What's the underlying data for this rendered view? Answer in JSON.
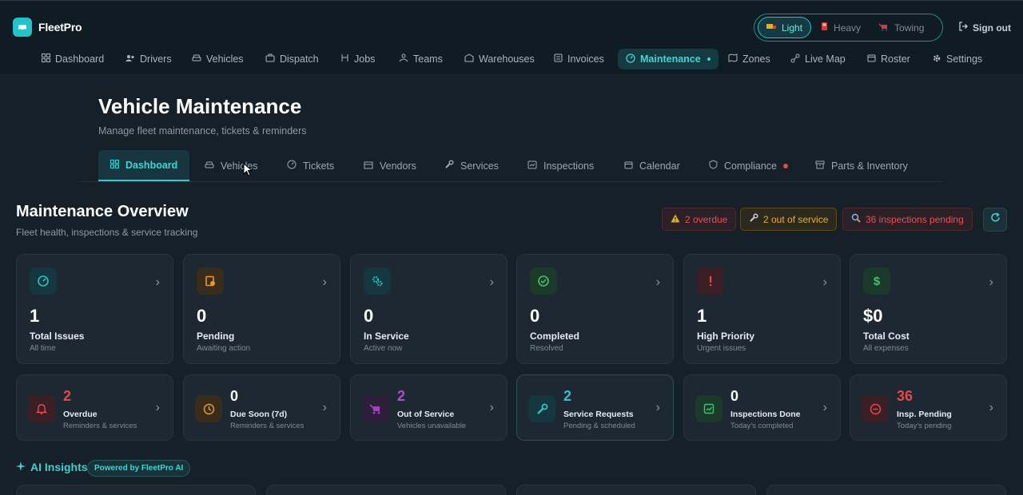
{
  "app": {
    "name": "FleetPro"
  },
  "modes": [
    {
      "label": "Light",
      "icon": "truck-icon",
      "active": true
    },
    {
      "label": "Heavy",
      "icon": "fuel-icon",
      "active": false
    },
    {
      "label": "Towing",
      "icon": "tow-truck-icon",
      "active": false
    }
  ],
  "signout": "Sign out",
  "nav": [
    {
      "label": "Dashboard",
      "icon": "grid-icon"
    },
    {
      "label": "Drivers",
      "icon": "users-icon"
    },
    {
      "label": "Vehicles",
      "icon": "car-icon"
    },
    {
      "label": "Dispatch",
      "icon": "briefcase-icon"
    },
    {
      "label": "Jobs",
      "icon": "jobs-icon"
    },
    {
      "label": "Teams",
      "icon": "team-icon"
    },
    {
      "label": "Warehouses",
      "icon": "warehouse-icon"
    },
    {
      "label": "Invoices",
      "icon": "invoice-icon"
    },
    {
      "label": "Maintenance",
      "icon": "gauge-icon",
      "active": true
    },
    {
      "label": "Zones",
      "icon": "map-icon"
    },
    {
      "label": "Live Map",
      "icon": "route-icon"
    },
    {
      "label": "Roster",
      "icon": "calendar-icon"
    },
    {
      "label": "Settings",
      "icon": "gear-icon"
    }
  ],
  "page": {
    "title": "Vehicle Maintenance",
    "subtitle": "Manage fleet maintenance, tickets & reminders"
  },
  "tabs": [
    {
      "label": "Dashboard",
      "icon": "grid-icon",
      "active": true
    },
    {
      "label": "Vehicles",
      "icon": "car-icon"
    },
    {
      "label": "Tickets",
      "icon": "gauge-icon"
    },
    {
      "label": "Vendors",
      "icon": "vendor-icon"
    },
    {
      "label": "Services",
      "icon": "wrench-icon"
    },
    {
      "label": "Inspections",
      "icon": "clipboard-icon"
    },
    {
      "label": "Calendar",
      "icon": "calendar-icon"
    },
    {
      "label": "Compliance",
      "icon": "shield-icon",
      "alert": true
    },
    {
      "label": "Parts & Inventory",
      "icon": "box-icon"
    }
  ],
  "overview": {
    "title": "Maintenance Overview",
    "subtitle": "Fleet health, inspections & service tracking",
    "alerts": [
      {
        "label": "2 overdue",
        "icon": "warning-icon",
        "color": "#e8524f"
      },
      {
        "label": "2 out of service",
        "icon": "wrench-icon",
        "color": "#e4b026"
      },
      {
        "label": "36 inspections pending",
        "icon": "magnifier-icon",
        "color": "#e8524f"
      }
    ]
  },
  "stats": [
    {
      "value": "1",
      "label": "Total Issues",
      "sub": "All time",
      "icon": "gauge-icon",
      "color": "#2fc1c4"
    },
    {
      "value": "0",
      "label": "Pending",
      "sub": "Awaiting action",
      "icon": "clipboard-clock-icon",
      "color": "#e49b2b"
    },
    {
      "value": "0",
      "label": "In Service",
      "sub": "Active now",
      "icon": "gears-icon",
      "color": "#2fc1c4"
    },
    {
      "value": "0",
      "label": "Completed",
      "sub": "Resolved",
      "icon": "check-circle-icon",
      "color": "#3ec46d"
    },
    {
      "value": "1",
      "label": "High Priority",
      "sub": "Urgent issues",
      "icon": "exclamation-icon",
      "color": "#e24a4a"
    },
    {
      "value": "$0",
      "label": "Total Cost",
      "sub": "All expenses",
      "icon": "dollar-icon",
      "color": "#3ec46d"
    }
  ],
  "mini_stats": [
    {
      "value": "2",
      "label": "Overdue",
      "sub": "Reminders & services",
      "icon": "bell-icon",
      "color": "#e24a4a"
    },
    {
      "value": "0",
      "label": "Due Soon (7d)",
      "sub": "Reminders & services",
      "icon": "clock-icon",
      "color": "#e49b2b"
    },
    {
      "value": "2",
      "label": "Out of Service",
      "sub": "Vehicles unavailable",
      "icon": "tow-truck-icon",
      "color": "#a43fc0"
    },
    {
      "value": "2",
      "label": "Service Requests",
      "sub": "Pending & scheduled",
      "icon": "wrench-icon",
      "color": "#2fc1c4"
    },
    {
      "value": "0",
      "label": "Inspections Done",
      "sub": "Today's completed",
      "icon": "checklist-icon",
      "color": "#3ec46d"
    },
    {
      "value": "36",
      "label": "Insp. Pending",
      "sub": "Today's pending",
      "icon": "minus-circle-icon",
      "color": "#e24a4a"
    }
  ],
  "ai": {
    "title": "AI Insights",
    "badge": "Powered by FleetPro AI"
  }
}
